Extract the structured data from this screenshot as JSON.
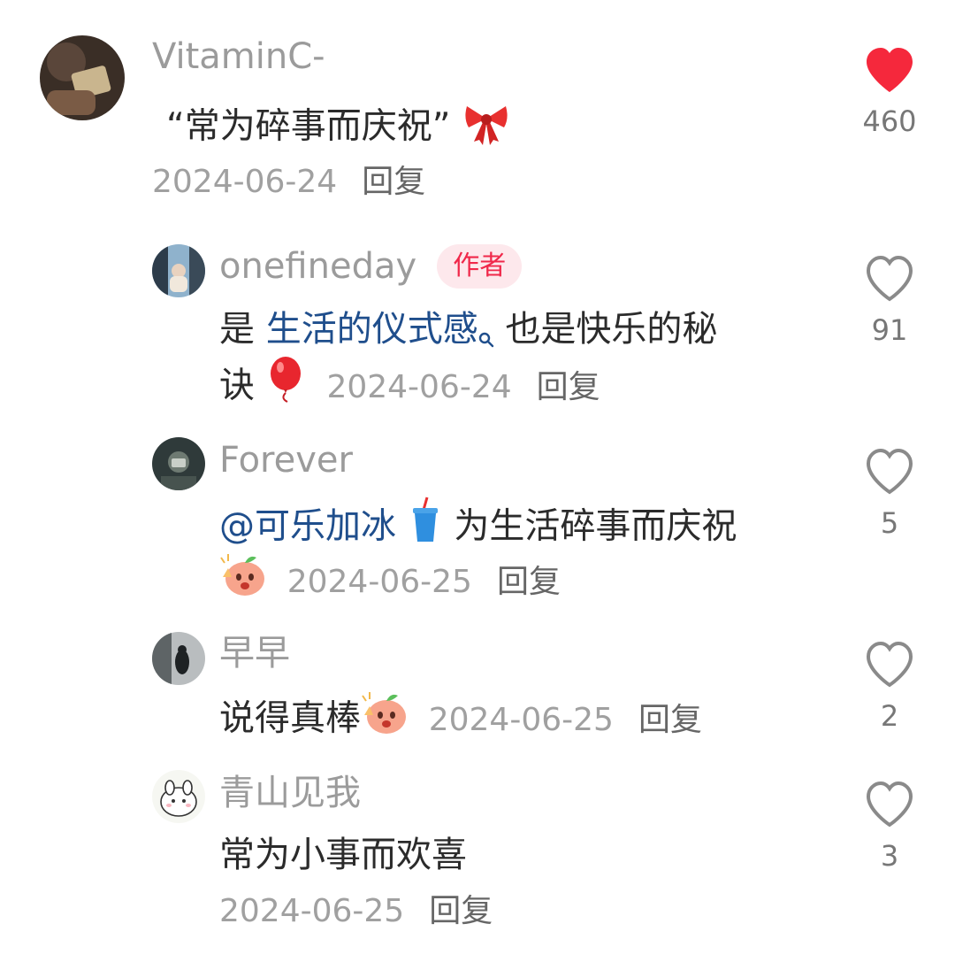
{
  "comments": [
    {
      "username": "VitaminC-",
      "text_open_quote": "“",
      "text_main": "常为碎事而庆祝",
      "text_close_quote": "”",
      "emoji": "ribbon-emoji",
      "date": "2024-06-24",
      "reply_label": "回复",
      "likes": "460",
      "liked": true
    },
    {
      "username": "onefineday",
      "badge": "作者",
      "text_prefix": "是 ",
      "text_link": "生活的仪式感",
      "text_line1_suffix": " 也是快乐的秘",
      "text_line2": "诀",
      "emoji": "balloon-emoji",
      "date": "2024-06-24",
      "reply_label": "回复",
      "likes": "91",
      "liked": false
    },
    {
      "username": "Forever",
      "mention": "@可乐加冰",
      "text_main": " 为生活碎事而庆祝",
      "emoji": "cup-emoji",
      "emoji2": "cheering-peach-emoji",
      "date": "2024-06-25",
      "reply_label": "回复",
      "likes": "5",
      "liked": false
    },
    {
      "username": "早早",
      "text_main": "说得真棒",
      "emoji": "cheering-peach-emoji",
      "date": "2024-06-25",
      "reply_label": "回复",
      "likes": "2",
      "liked": false
    },
    {
      "username": "青山见我",
      "text_main": "常为小事而欢喜",
      "date": "2024-06-25",
      "reply_label": "回复",
      "likes": "3",
      "liked": false
    }
  ],
  "colors": {
    "like_active": "#f5283c",
    "mention_link": "#1f4e8c",
    "author_badge_bg": "#fde8ec",
    "author_badge_text": "#f0284a"
  }
}
